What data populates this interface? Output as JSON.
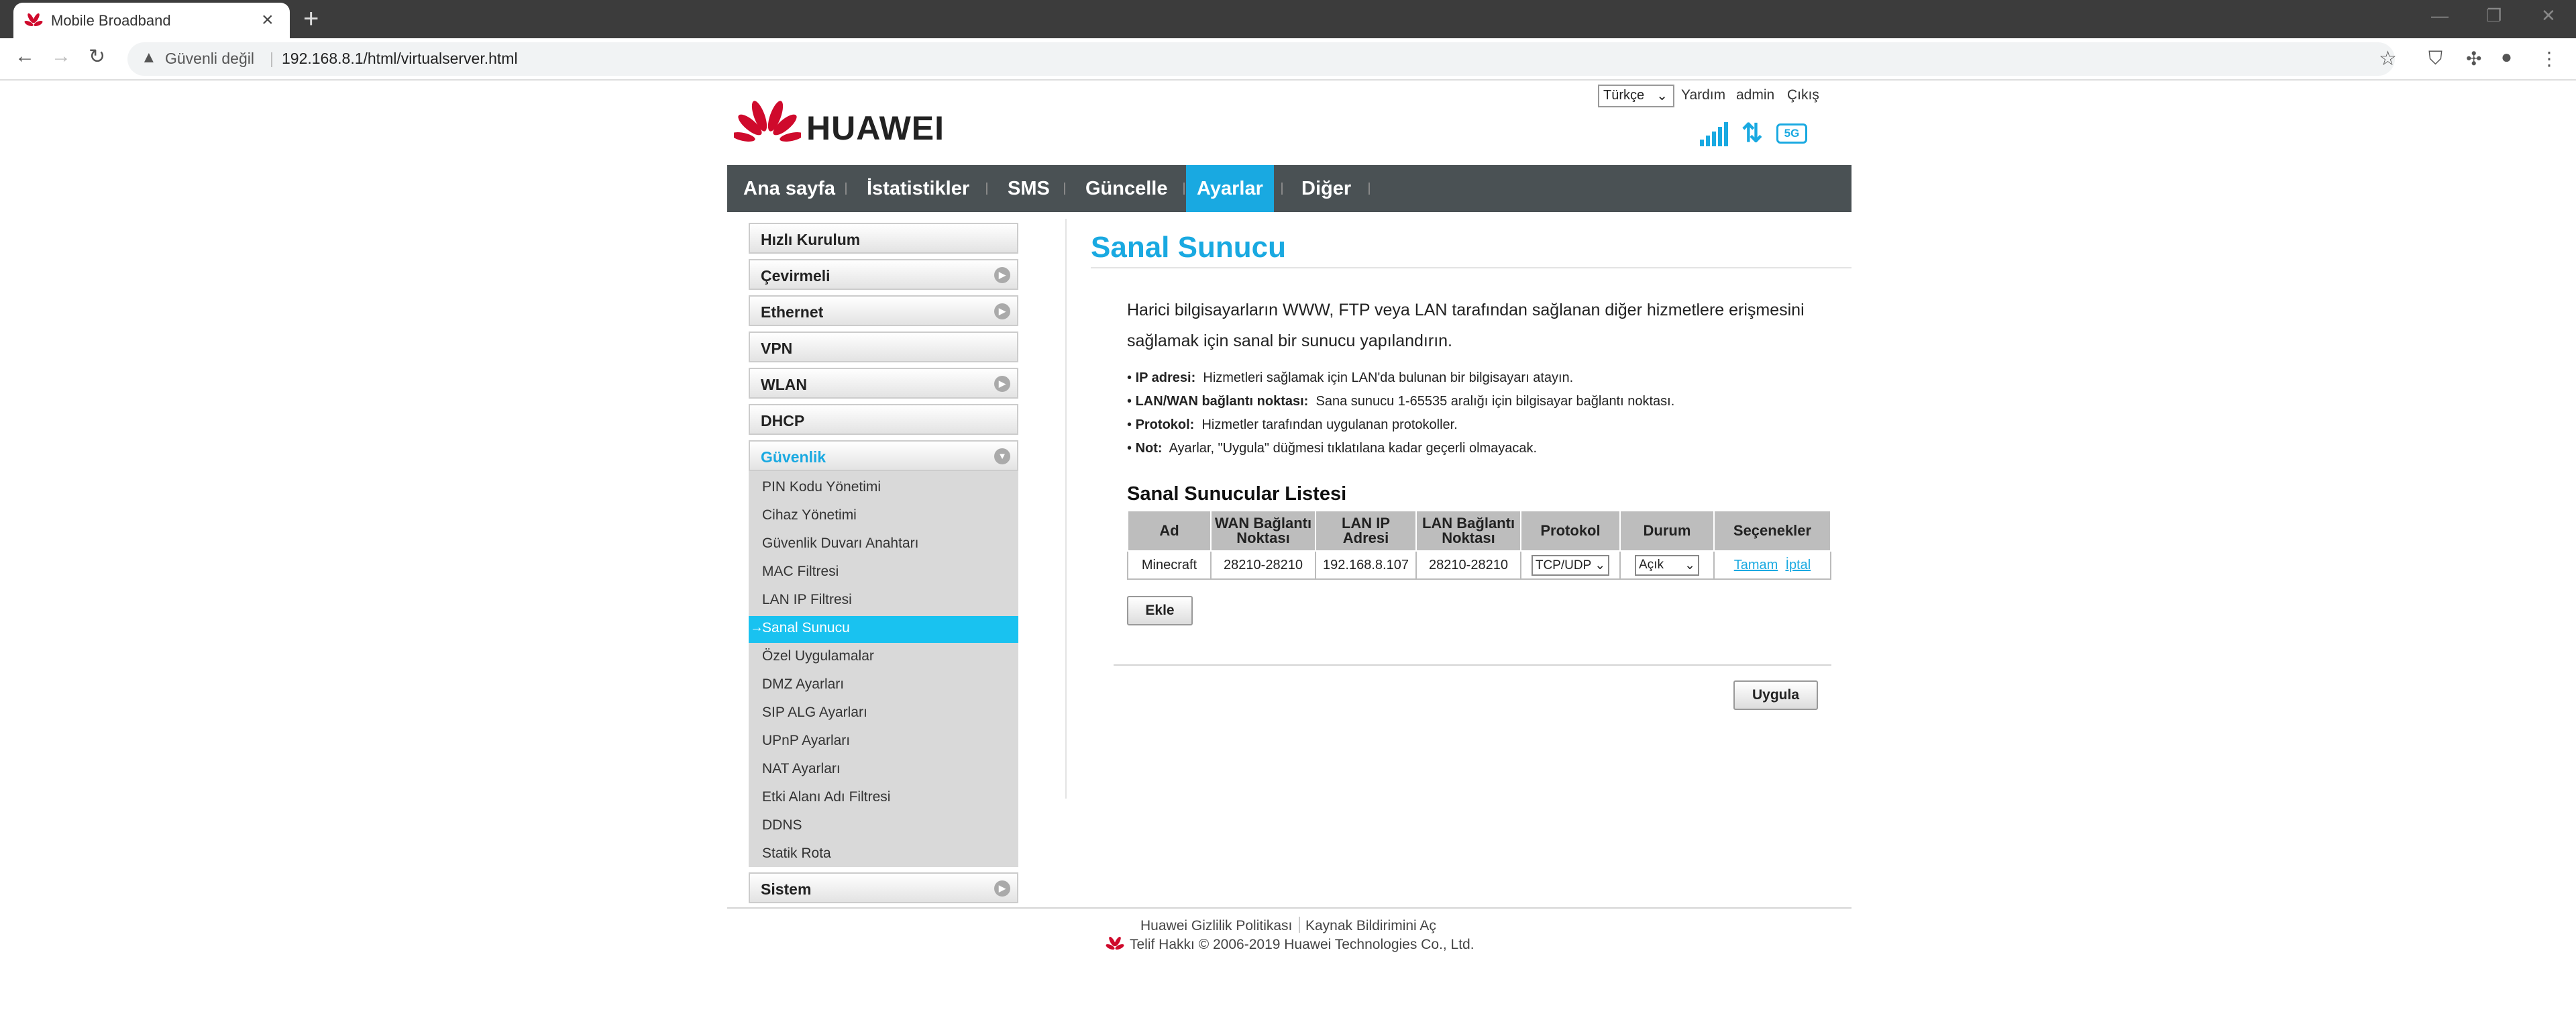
{
  "browser": {
    "tab_title": "Mobile Broadband",
    "new_tab": "+",
    "security": "Güvenli değil",
    "url": "192.168.8.1/html/virtualserver.html",
    "sep": "|"
  },
  "brand": {
    "name": "HUAWEI",
    "color": "#cf0a2c"
  },
  "header": {
    "language": "Türkçe",
    "help": "Yardım",
    "user": "admin",
    "logout": "Çıkış",
    "network": "5G"
  },
  "menu": [
    "Ana sayfa",
    "İstatistikler",
    "SMS",
    "Güncelle",
    "Ayarlar",
    "Diğer"
  ],
  "sidebar": {
    "sections": [
      "Hızlı Kurulum",
      "Çevirmeli",
      "Ethernet",
      "VPN",
      "WLAN",
      "DHCP",
      "Güvenlik",
      "Sistem"
    ],
    "security_items": [
      "PIN Kodu Yönetimi",
      "Cihaz Yönetimi",
      "Güvenlik Duvarı Anahtarı",
      "MAC Filtresi",
      "LAN IP Filtresi",
      "Sanal Sunucu",
      "Özel Uygulamalar",
      "DMZ Ayarları",
      "SIP ALG Ayarları",
      "UPnP Ayarları",
      "NAT Ayarları",
      "Etki Alanı Adı Filtresi",
      "DDNS",
      "Statik Rota"
    ]
  },
  "content": {
    "title": "Sanal Sunucu",
    "desc1": "Harici bilgisayarların WWW, FTP veya LAN tarafından sağlanan diğer hizmetlere erişmesini",
    "desc2": "sağlamak için sanal bir sunucu yapılandırın.",
    "bullets": [
      {
        "term": "IP adresi:",
        "text": "Hizmetleri sağlamak için LAN'da bulunan bir bilgisayarı atayın."
      },
      {
        "term": "LAN/WAN bağlantı noktası:",
        "text": "Sana sunucu 1-65535 aralığı için bilgisayar bağlantı noktası."
      },
      {
        "term": "Protokol:",
        "text": "Hizmetler tarafından uygulanan protokoller."
      },
      {
        "term": "Not:",
        "text": "Ayarlar, \"Uygula\" düğmesi tıklatılana kadar geçerli olmayacak."
      }
    ],
    "list_title": "Sanal Sunucular Listesi",
    "columns": [
      "Ad",
      "WAN Bağlantı Noktası",
      "LAN IP Adresi",
      "LAN Bağlantı Noktası",
      "Protokol",
      "Durum",
      "Seçenekler"
    ],
    "rows": [
      {
        "name": "Minecraft",
        "wan": "28210-28210",
        "ip": "192.168.8.107",
        "lan": "28210-28210",
        "protocol": "TCP/UDP",
        "status": "Açık",
        "ok": "Tamam",
        "cancel": "İptal"
      }
    ],
    "add": "Ekle",
    "apply": "Uygula"
  },
  "footer": {
    "privacy": "Huawei Gizlilik Politikası",
    "source": "Kaynak Bildirimini Aç",
    "copyright": "Telif Hakkı © 2006-2019 Huawei Technologies Co., Ltd."
  },
  "colors": {
    "accent": "#19a9e1",
    "menu_bg": "#4a5154",
    "selected": "#19c2f0"
  }
}
